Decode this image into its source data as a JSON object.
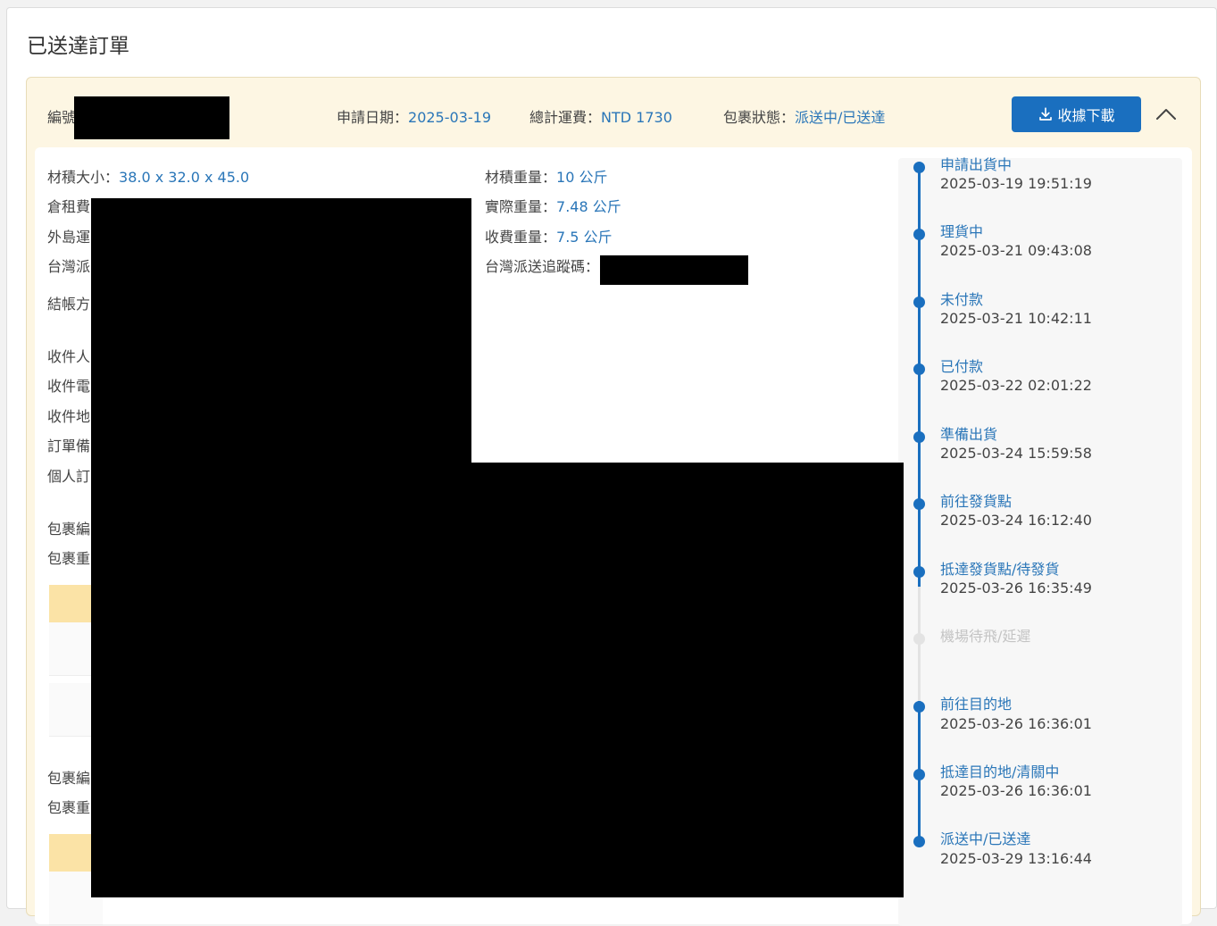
{
  "page_title": "已送達訂單",
  "order": {
    "number_label": "編號",
    "apply_date_label": "申請日期：",
    "apply_date": "2025-03-19",
    "total_fee_label": "總計運費：",
    "total_fee": "NTD 1730",
    "status_label": "包裹狀態：",
    "status": "派送中/已送達",
    "download_label": "收據下載"
  },
  "details_left": [
    {
      "label": "材積大小：",
      "value": "38.0 x 32.0 x 45.0"
    },
    {
      "label": "倉租費",
      "value": ""
    },
    {
      "label": "外島運",
      "value": ""
    },
    {
      "label": "台灣派",
      "value": ""
    },
    {
      "label": "結帳方",
      "value": ""
    },
    {
      "label": "收件人",
      "value": ""
    },
    {
      "label": "收件電",
      "value": ""
    },
    {
      "label": "收件地",
      "value": ""
    },
    {
      "label": "訂單備",
      "value": ""
    },
    {
      "label": "個人訂",
      "value": ""
    },
    {
      "label": "包裹編",
      "value": ""
    },
    {
      "label": "包裹重",
      "value": ""
    },
    {
      "label": "包裹編",
      "value": ""
    },
    {
      "label": "包裹重",
      "value": ""
    }
  ],
  "details_right": [
    {
      "label": "材積重量：",
      "value": "10 公斤"
    },
    {
      "label": "實際重量：",
      "value": "7.48 公斤"
    },
    {
      "label": "收費重量：",
      "value": "7.5 公斤"
    },
    {
      "label": "台灣派送追蹤碼：",
      "value": ""
    }
  ],
  "timeline": [
    {
      "label": "申請出貨中",
      "time": "2025-03-19 19:51:19",
      "active": true
    },
    {
      "label": "理貨中",
      "time": "2025-03-21 09:43:08",
      "active": true
    },
    {
      "label": "未付款",
      "time": "2025-03-21 10:42:11",
      "active": true
    },
    {
      "label": "已付款",
      "time": "2025-03-22 02:01:22",
      "active": true
    },
    {
      "label": "準備出貨",
      "time": "2025-03-24 15:59:58",
      "active": true
    },
    {
      "label": "前往發貨點",
      "time": "2025-03-24 16:12:40",
      "active": true
    },
    {
      "label": "抵達發貨點/待發貨",
      "time": "2025-03-26 16:35:49",
      "active": true
    },
    {
      "label": "機場待飛/延遲",
      "time": "",
      "active": false
    },
    {
      "label": "前往目的地",
      "time": "2025-03-26 16:36:01",
      "active": true
    },
    {
      "label": "抵達目的地/清關中",
      "time": "2025-03-26 16:36:01",
      "active": true
    },
    {
      "label": "派送中/已送達",
      "time": "2025-03-29 13:16:44",
      "active": true
    }
  ],
  "colors": {
    "accent": "#2a76b8",
    "button": "#1a6fbf",
    "card_bg": "#fdf6e3",
    "table_header": "#fbe3a6",
    "timeline_inactive": "#d9d9d9"
  },
  "icons": {
    "download": "download-icon",
    "collapse": "chevron-up-icon"
  }
}
